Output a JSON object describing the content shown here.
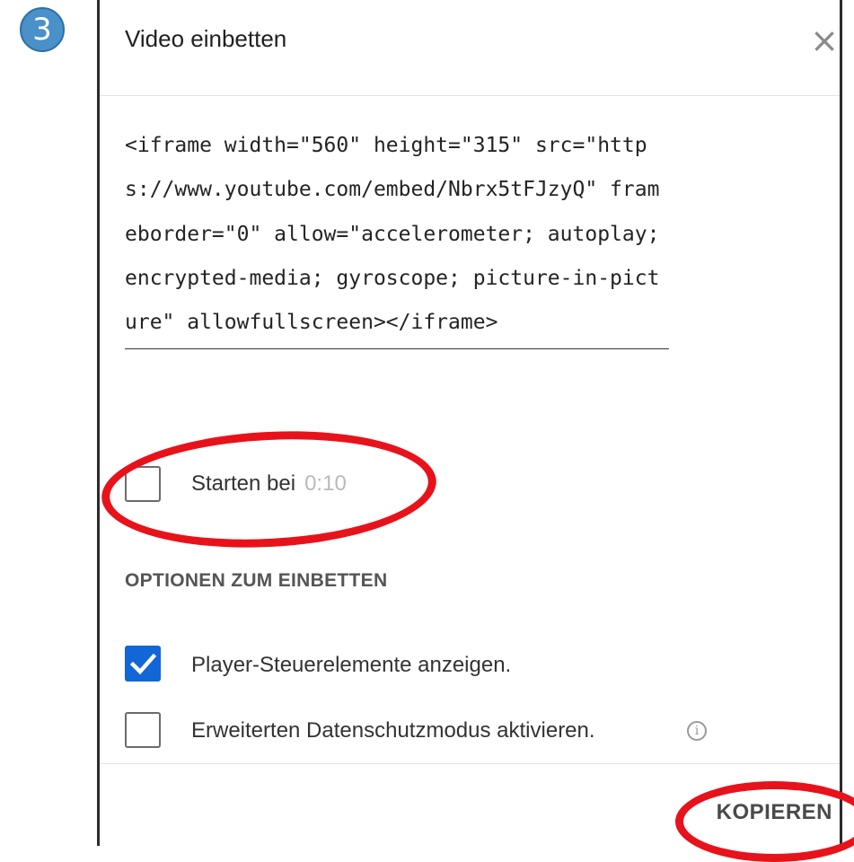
{
  "step_badge": "3",
  "dialog": {
    "title": "Video einbetten",
    "close_glyph": "×",
    "embed_code": "<iframe width=\"560\" height=\"315\" src=\"https://www.youtube.com/embed/Nbrx5tFJzyQ\" frameborder=\"0\" allow=\"accelerometer; autoplay; encrypted-media; gyroscope; picture-in-picture\" allowfullscreen></iframe>",
    "start_at": {
      "label": "Starten bei",
      "time": "0:10",
      "checked": false
    },
    "options_header": "OPTIONEN ZUM EINBETTEN",
    "options": [
      {
        "label": "Player-Steuerelemente anzeigen.",
        "checked": true
      },
      {
        "label": "Erweiterten Datenschutzmodus aktivieren.",
        "checked": false,
        "info_icon": "info-icon"
      }
    ],
    "copy_button": "KOPIEREN"
  },
  "colors": {
    "checkbox_checked": "#1266d6",
    "annotation_red": "#e8121b",
    "badge_blue": "#4a90c9"
  }
}
